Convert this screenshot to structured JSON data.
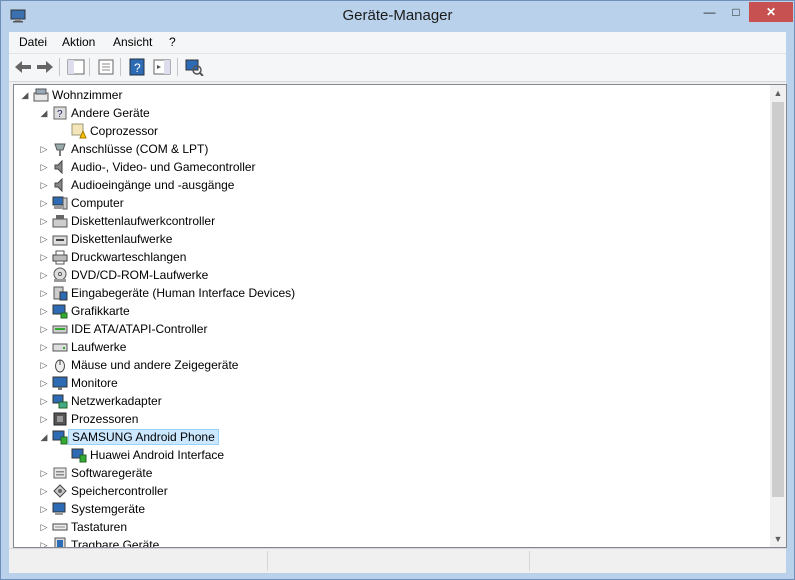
{
  "window": {
    "title": "Geräte-Manager"
  },
  "menu": [
    {
      "name": "menu-datei",
      "label": "Datei"
    },
    {
      "name": "menu-aktion",
      "label": "Aktion"
    },
    {
      "name": "menu-ansicht",
      "label": "Ansicht"
    },
    {
      "name": "menu-help",
      "label": "?"
    }
  ],
  "toolbar": [
    {
      "name": "back-button",
      "icon": "arrow-left-icon"
    },
    {
      "name": "forward-button",
      "icon": "arrow-right-icon"
    },
    {
      "name": "show-hide-console-tree-button",
      "icon": "console-tree-icon"
    },
    {
      "name": "properties-button",
      "icon": "properties-icon"
    },
    {
      "name": "help-button",
      "icon": "help-icon"
    },
    {
      "name": "action-pane-button",
      "icon": "action-pane-icon"
    },
    {
      "name": "scan-hardware-button",
      "icon": "scan-hardware-icon"
    }
  ],
  "tree": [
    {
      "label": "Wohnzimmer",
      "level": 0,
      "expander": "expanded",
      "icon": "computer-root-icon"
    },
    {
      "label": "Andere Geräte",
      "level": 1,
      "expander": "expanded",
      "icon": "unknown-device-icon"
    },
    {
      "label": "Coprozessor",
      "level": 2,
      "expander": "none",
      "icon": "warning-device-icon"
    },
    {
      "label": "Anschlüsse (COM & LPT)",
      "level": 1,
      "expander": "collapsed",
      "icon": "port-icon"
    },
    {
      "label": "Audio-, Video- und Gamecontroller",
      "level": 1,
      "expander": "collapsed",
      "icon": "speaker-icon"
    },
    {
      "label": "Audioeingänge und -ausgänge",
      "level": 1,
      "expander": "collapsed",
      "icon": "speaker-icon"
    },
    {
      "label": "Computer",
      "level": 1,
      "expander": "collapsed",
      "icon": "computer-icon"
    },
    {
      "label": "Diskettenlaufwerkcontroller",
      "level": 1,
      "expander": "collapsed",
      "icon": "floppy-controller-icon"
    },
    {
      "label": "Diskettenlaufwerke",
      "level": 1,
      "expander": "collapsed",
      "icon": "floppy-drive-icon"
    },
    {
      "label": "Druckwarteschlangen",
      "level": 1,
      "expander": "collapsed",
      "icon": "printer-icon"
    },
    {
      "label": "DVD/CD-ROM-Laufwerke",
      "level": 1,
      "expander": "collapsed",
      "icon": "disc-drive-icon"
    },
    {
      "label": "Eingabegeräte (Human Interface Devices)",
      "level": 1,
      "expander": "collapsed",
      "icon": "hid-icon"
    },
    {
      "label": "Grafikkarte",
      "level": 1,
      "expander": "collapsed",
      "icon": "display-adapter-icon"
    },
    {
      "label": "IDE ATA/ATAPI-Controller",
      "level": 1,
      "expander": "collapsed",
      "icon": "ide-controller-icon"
    },
    {
      "label": "Laufwerke",
      "level": 1,
      "expander": "collapsed",
      "icon": "disk-drive-icon"
    },
    {
      "label": "Mäuse und andere Zeigegeräte",
      "level": 1,
      "expander": "collapsed",
      "icon": "mouse-icon"
    },
    {
      "label": "Monitore",
      "level": 1,
      "expander": "collapsed",
      "icon": "monitor-icon"
    },
    {
      "label": "Netzwerkadapter",
      "level": 1,
      "expander": "collapsed",
      "icon": "network-adapter-icon"
    },
    {
      "label": "Prozessoren",
      "level": 1,
      "expander": "collapsed",
      "icon": "processor-icon"
    },
    {
      "label": "SAMSUNG Android Phone",
      "level": 1,
      "expander": "expanded",
      "icon": "phone-device-icon",
      "selected": true
    },
    {
      "label": "Huawei Android Interface",
      "level": 2,
      "expander": "none",
      "icon": "phone-device-icon"
    },
    {
      "label": "Softwaregeräte",
      "level": 1,
      "expander": "collapsed",
      "icon": "software-device-icon"
    },
    {
      "label": "Speichercontroller",
      "level": 1,
      "expander": "collapsed",
      "icon": "storage-controller-icon"
    },
    {
      "label": "Systemgeräte",
      "level": 1,
      "expander": "collapsed",
      "icon": "system-device-icon"
    },
    {
      "label": "Tastaturen",
      "level": 1,
      "expander": "collapsed",
      "icon": "keyboard-icon"
    },
    {
      "label": "Tragbare Geräte",
      "level": 1,
      "expander": "collapsed",
      "icon": "portable-device-icon"
    }
  ],
  "colors": {
    "selection": "#cce8ff",
    "selection_border": "#99d1ff",
    "frame": "#b9d1ea",
    "close_button": "#c75050"
  }
}
